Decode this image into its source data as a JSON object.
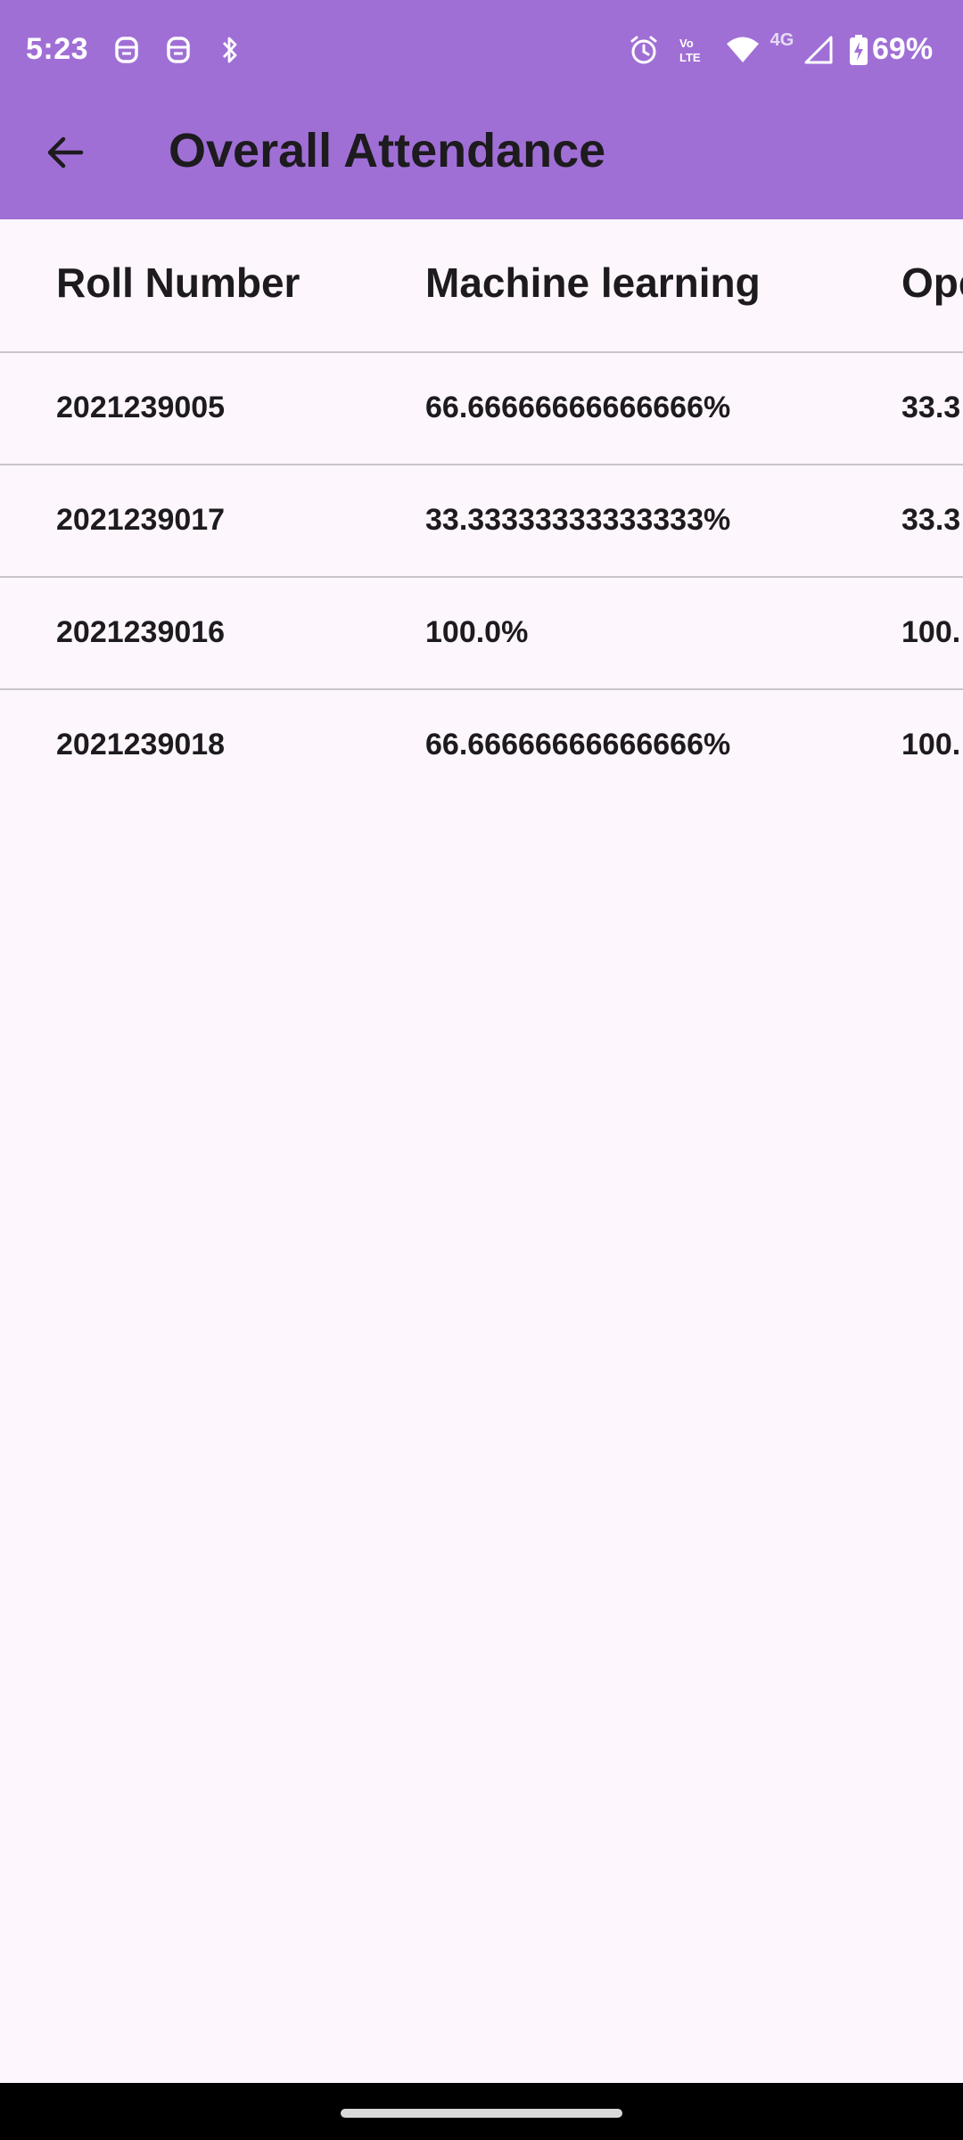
{
  "colors": {
    "app_bar": "#a06fd6",
    "background": "#fdf6fd",
    "text": "#1d1b1e",
    "divider": "#c9c3cb"
  },
  "status_bar": {
    "time": "5:23",
    "battery": "69%",
    "network": "4G",
    "icons": [
      "notification-icon",
      "notification-icon",
      "bluetooth-icon",
      "alarm-icon",
      "volte-icon",
      "wifi-icon",
      "signal-icon",
      "battery-icon"
    ]
  },
  "app_bar": {
    "title": "Overall Attendance",
    "back_icon": "arrow-back-icon"
  },
  "table": {
    "headers": [
      "Roll Number",
      "Machine learning",
      "Ope"
    ],
    "rows": [
      [
        "2021239005",
        "66.66666666666666%",
        "33.3"
      ],
      [
        "2021239017",
        "33.33333333333333%",
        "33.3"
      ],
      [
        "2021239016",
        "100.0%",
        "100."
      ],
      [
        "2021239018",
        "66.66666666666666%",
        "100."
      ]
    ]
  }
}
